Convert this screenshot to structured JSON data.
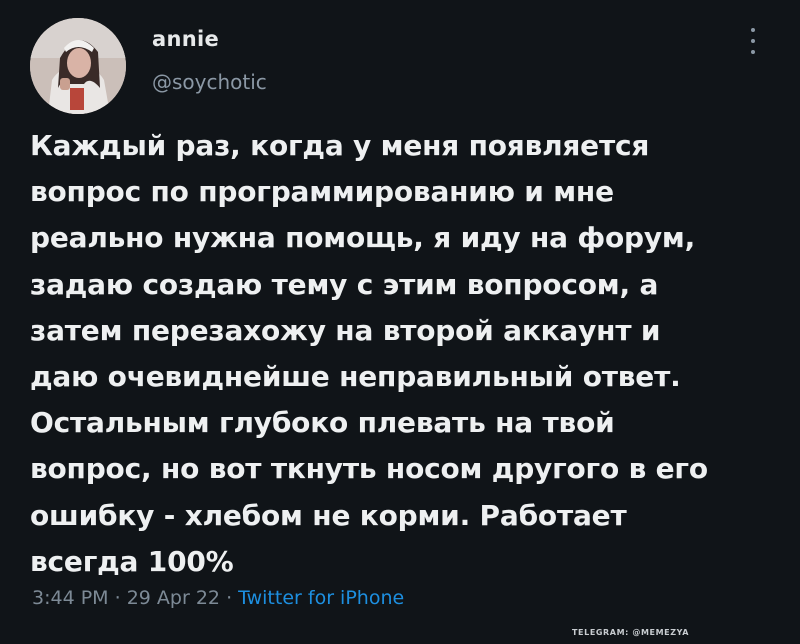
{
  "tweet": {
    "author": {
      "display_name": "annie",
      "handle": "@soychotic"
    },
    "text_lines": [
      "Каждый раз, когда у меня появляется",
      "вопрос по программированию и мне",
      "реально нужна помощь,  я иду на форум,",
      "задаю создаю тему с этим вопросом, а",
      "затем перезахожу на второй аккаунт и",
      "даю очевиднейше неправильный ответ.",
      "Остальным глубоко плевать на твой",
      "вопрос, но вот ткнуть носом другого в его",
      "ошибку - хлебом не корми. Работает",
      "всегда 100%"
    ],
    "meta": {
      "time": "3:44 PM",
      "date": "29 Apr 22",
      "source": "Twitter for iPhone",
      "separator": "·"
    }
  },
  "watermark": "TELEGRAM: @MEMEZYA",
  "colors": {
    "background": "#101418",
    "text": "#e7e9ea",
    "secondary": "#8b98a5",
    "link": "#1d8fe0"
  },
  "icons": {
    "more": "vertical-ellipsis-icon"
  }
}
